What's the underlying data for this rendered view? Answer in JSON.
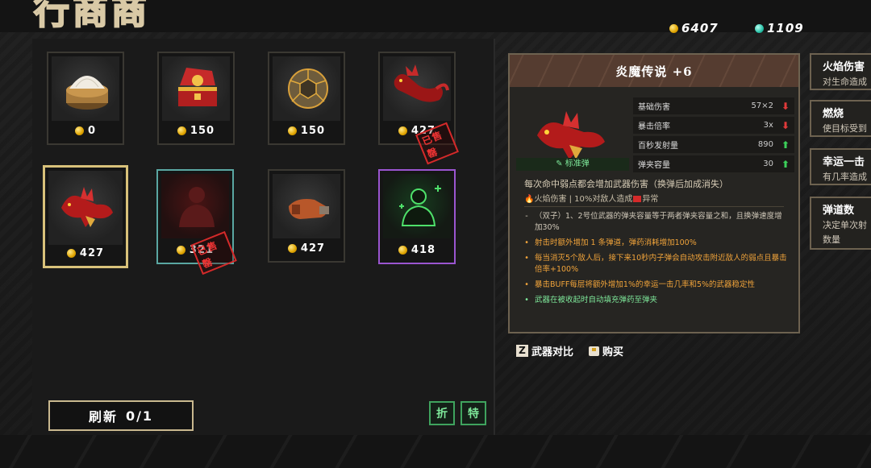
{
  "header": {
    "title": "行商商"
  },
  "currency": {
    "gold": "6407",
    "gems": "1109"
  },
  "shop_items": [
    {
      "name": "Rice Steamer",
      "price": "0",
      "sold_out": false
    },
    {
      "name": "Red Treasure Chest",
      "price": "150",
      "sold_out": false
    },
    {
      "name": "Hex Sphere",
      "price": "150",
      "sold_out": false
    },
    {
      "name": "Red Dragon",
      "price": "427",
      "sold_out": true
    },
    {
      "name": "Flame Dragon Gun",
      "price": "427",
      "sold_out": false,
      "selected": true
    },
    {
      "name": "Shadow Figure",
      "price": "321",
      "sold_out": true
    },
    {
      "name": "Gauntlet",
      "price": "427",
      "sold_out": false
    },
    {
      "name": "Healing Figure",
      "price": "418",
      "sold_out": false
    }
  ],
  "sold_label": "已售罄",
  "refresh": {
    "label": "刷新",
    "count": "0/1"
  },
  "tag_buttons": {
    "discount": "折",
    "special": "特"
  },
  "detail": {
    "title": "炎魔传说 +6",
    "weapon_type": "标准弹",
    "stats": [
      {
        "label": "基础伤害",
        "value": "57×2",
        "trend": "down"
      },
      {
        "label": "暴击倍率",
        "value": "3x",
        "trend": "down"
      },
      {
        "label": "百秒发射量",
        "value": "890",
        "trend": "up"
      },
      {
        "label": "弹夹容量",
        "value": "30",
        "trend": "up"
      }
    ],
    "desc_main": "每次命中弱点都会增加武器伤害（换弹后加成消失）",
    "desc_sub_prefix": "火焰伤害 | 10%对敌人造成",
    "desc_sub_suffix": "异常",
    "effects": [
      {
        "style": "gray",
        "bullet": "-",
        "text": "（双子）1、2号位武器的弹夹容量等于两者弹夹容量之和，且换弹速度增加30%"
      },
      {
        "style": "orange",
        "bullet": "•",
        "text": "射击时额外增加 1 条弹道，弹药消耗增加100%"
      },
      {
        "style": "orange",
        "bullet": "•",
        "text": "每当消灭5个敌人后，接下来10秒内子弹会自动攻击附近敌人的弱点且暴击倍率+100%"
      },
      {
        "style": "orange",
        "bullet": "•",
        "text": "暴击BUFF每层将额外增加1%的幸运一击几率和5%的武器稳定性"
      },
      {
        "style": "green",
        "bullet": "•",
        "text": "武器在被收起时自动填充弹药至弹夹"
      }
    ]
  },
  "hints": {
    "compare_key": "Z",
    "compare_label": "武器对比",
    "buy_label": "购买"
  },
  "side_cards": [
    {
      "title": "火焰伤害",
      "desc": "对生命造成"
    },
    {
      "title": "燃烧",
      "desc": "使目标受到"
    },
    {
      "title": "幸运一击",
      "desc": "有几率造成"
    },
    {
      "title": "弹道数",
      "desc": "决定单次射",
      "desc2": "数量"
    }
  ],
  "colors": {
    "gold_border": "#d8c17a",
    "cyan_border": "#5aa7a2",
    "purple_border": "#9a55d0",
    "panel_border": "#6d6250"
  }
}
